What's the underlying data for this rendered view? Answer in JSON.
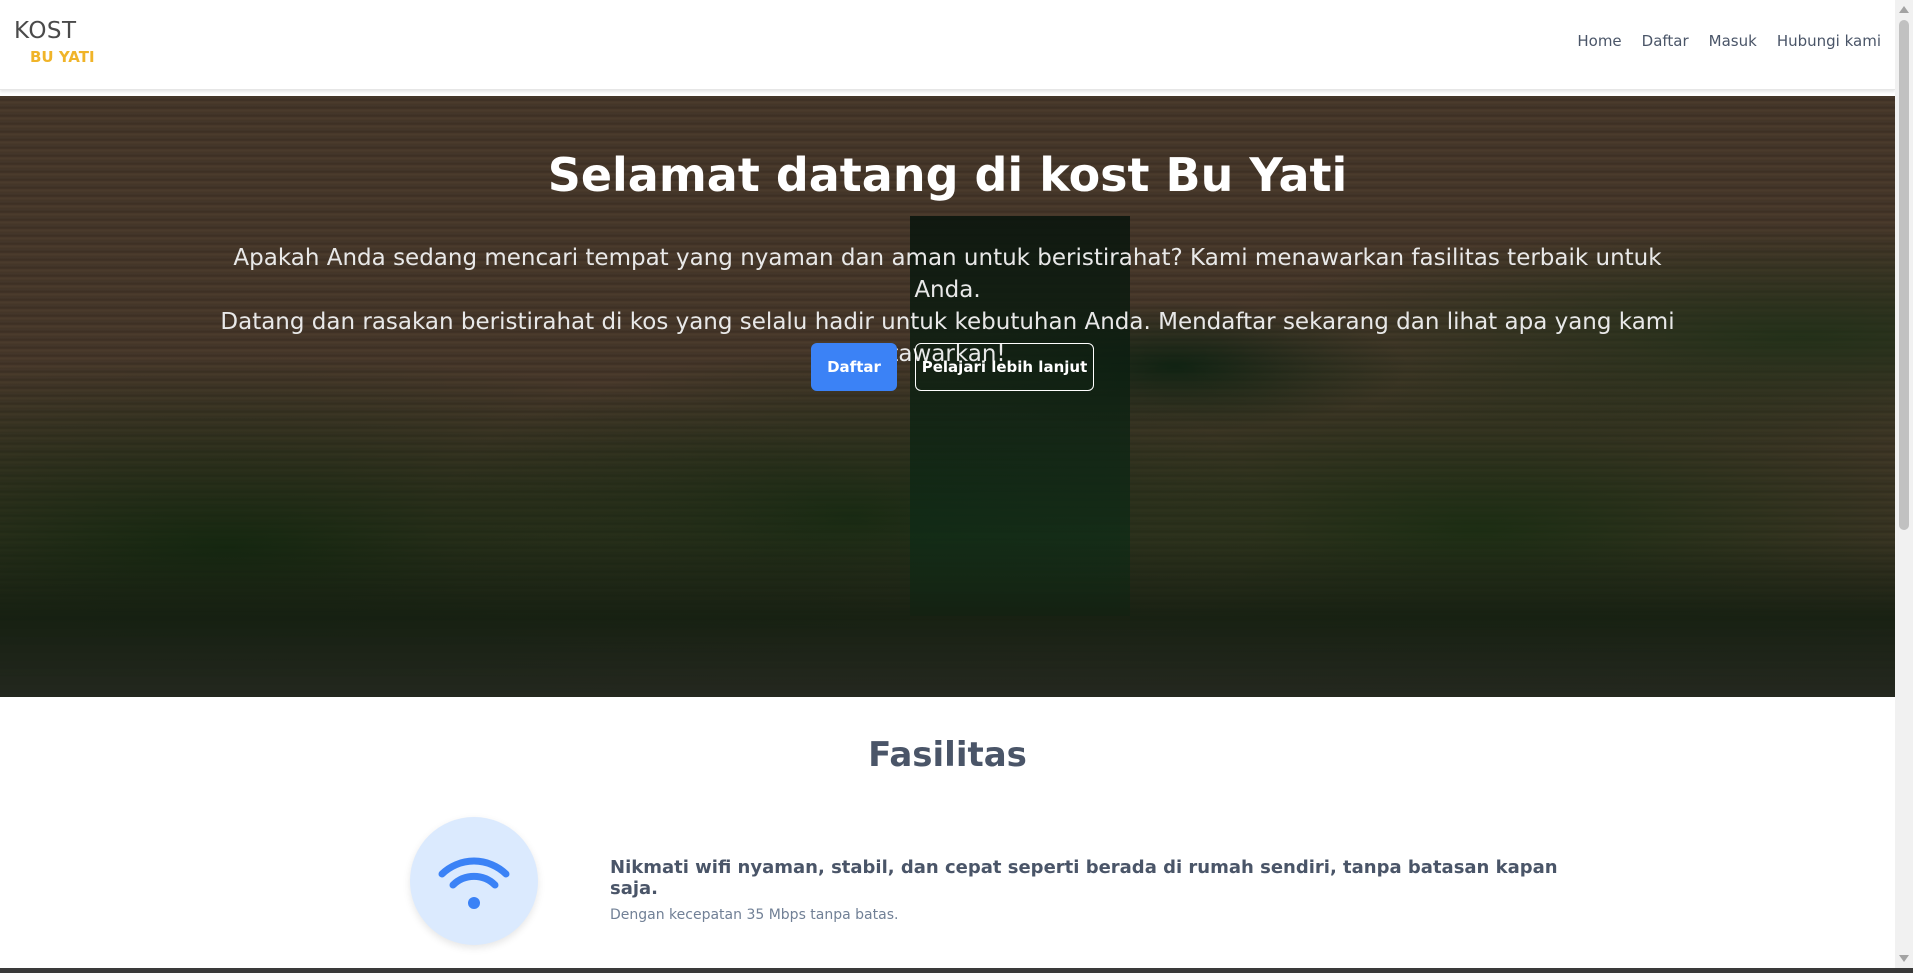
{
  "brand": {
    "main": "KOST",
    "sub": "BU YATI"
  },
  "nav": {
    "items": [
      {
        "label": "Home"
      },
      {
        "label": "Daftar"
      },
      {
        "label": "Masuk"
      },
      {
        "label": "Hubungi kami"
      }
    ]
  },
  "hero": {
    "title": "Selamat datang di kost Bu Yati",
    "description_line1": "Apakah Anda sedang mencari tempat yang nyaman dan aman untuk beristirahat? Kami menawarkan fasilitas terbaik untuk Anda.",
    "description_line2": "Datang dan rasakan beristirahat di kos yang selalu hadir untuk kebutuhan Anda. Mendaftar sekarang dan lihat apa yang kami tawarkan!",
    "primary_button": "Daftar",
    "secondary_button": "Pelajari lebih lanjut"
  },
  "facilities": {
    "title": "Fasilitas",
    "items": [
      {
        "icon": "wifi-icon",
        "heading": "Nikmati wifi nyaman, stabil, dan cepat seperti berada di rumah sendiri, tanpa batasan kapan saja.",
        "subtext": "Dengan kecepatan 35 Mbps tanpa batas."
      }
    ]
  },
  "colors": {
    "accent": "#3b82f6",
    "brand_sub": "#f0b429",
    "icon_circle": "#dbeafe"
  }
}
